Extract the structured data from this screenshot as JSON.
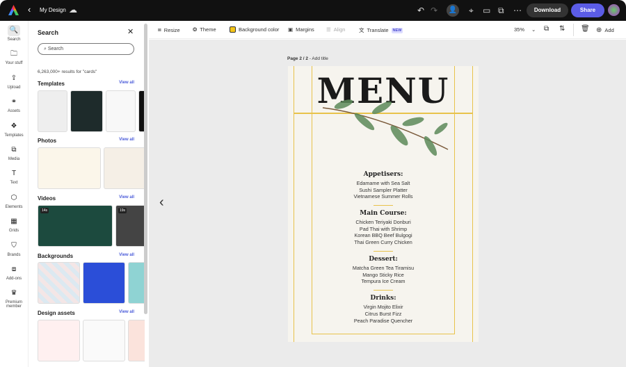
{
  "header": {
    "back": "‹",
    "title": "My Design",
    "download": "Download",
    "share": "Share"
  },
  "toolbar": {
    "resize": "Resize",
    "theme": "Theme",
    "background_color": "Background color",
    "bg_swatch": "#f5c518",
    "margins": "Margins",
    "align": "Align",
    "translate": "Translate",
    "new_badge": "NEW",
    "zoom": "35%",
    "add": "Add"
  },
  "rail": [
    {
      "label": "Search",
      "icon": "🔍"
    },
    {
      "label": "Your stuff",
      "icon": "🗀"
    },
    {
      "label": "Upload",
      "icon": "⇪"
    },
    {
      "label": "Assets",
      "icon": "⚭"
    },
    {
      "label": "Templates",
      "icon": "❖"
    },
    {
      "label": "Media",
      "icon": "⧉"
    },
    {
      "label": "Text",
      "icon": "T"
    },
    {
      "label": "Elements",
      "icon": "⬡"
    },
    {
      "label": "Grids",
      "icon": "▦"
    },
    {
      "label": "Brands",
      "icon": "⛉"
    },
    {
      "label": "Add-ons",
      "icon": "⧈"
    },
    {
      "label": "Premium member",
      "icon": "♛"
    }
  ],
  "panel": {
    "title": "Search",
    "search_placeholder": "Search",
    "results": "6,263,000+ results for \"cards\"",
    "view_all": "View all",
    "sections": [
      "Templates",
      "Photos",
      "Videos",
      "Backgrounds",
      "Design assets"
    ],
    "video_durations": [
      "14s",
      "19s"
    ]
  },
  "canvas": {
    "page_label": "Page 2 / 2",
    "add_title": "Add title",
    "prev": "‹"
  },
  "menu": {
    "title": "MENU",
    "sections": [
      {
        "heading": "Appetisers:",
        "items": [
          "Edamame with Sea Salt",
          "Sushi Sampler Platter",
          "Vietnamese Summer Rolls"
        ]
      },
      {
        "heading": "Main Course:",
        "items": [
          "Chicken Teriyaki Donburi",
          "Pad Thai with Shrimp",
          "Korean BBQ Beef Bulgogi",
          "Thai Green Curry Chicken"
        ]
      },
      {
        "heading": "Dessert:",
        "items": [
          "Matcha Green Tea Tiramisu",
          "Mango Sticky Rice",
          "Tempura Ice Cream"
        ]
      },
      {
        "heading": "Drinks:",
        "items": [
          "Virgin Mojito Elixir",
          "Citrus Burst Fizz",
          "Peach Paradise Quencher"
        ]
      }
    ]
  }
}
